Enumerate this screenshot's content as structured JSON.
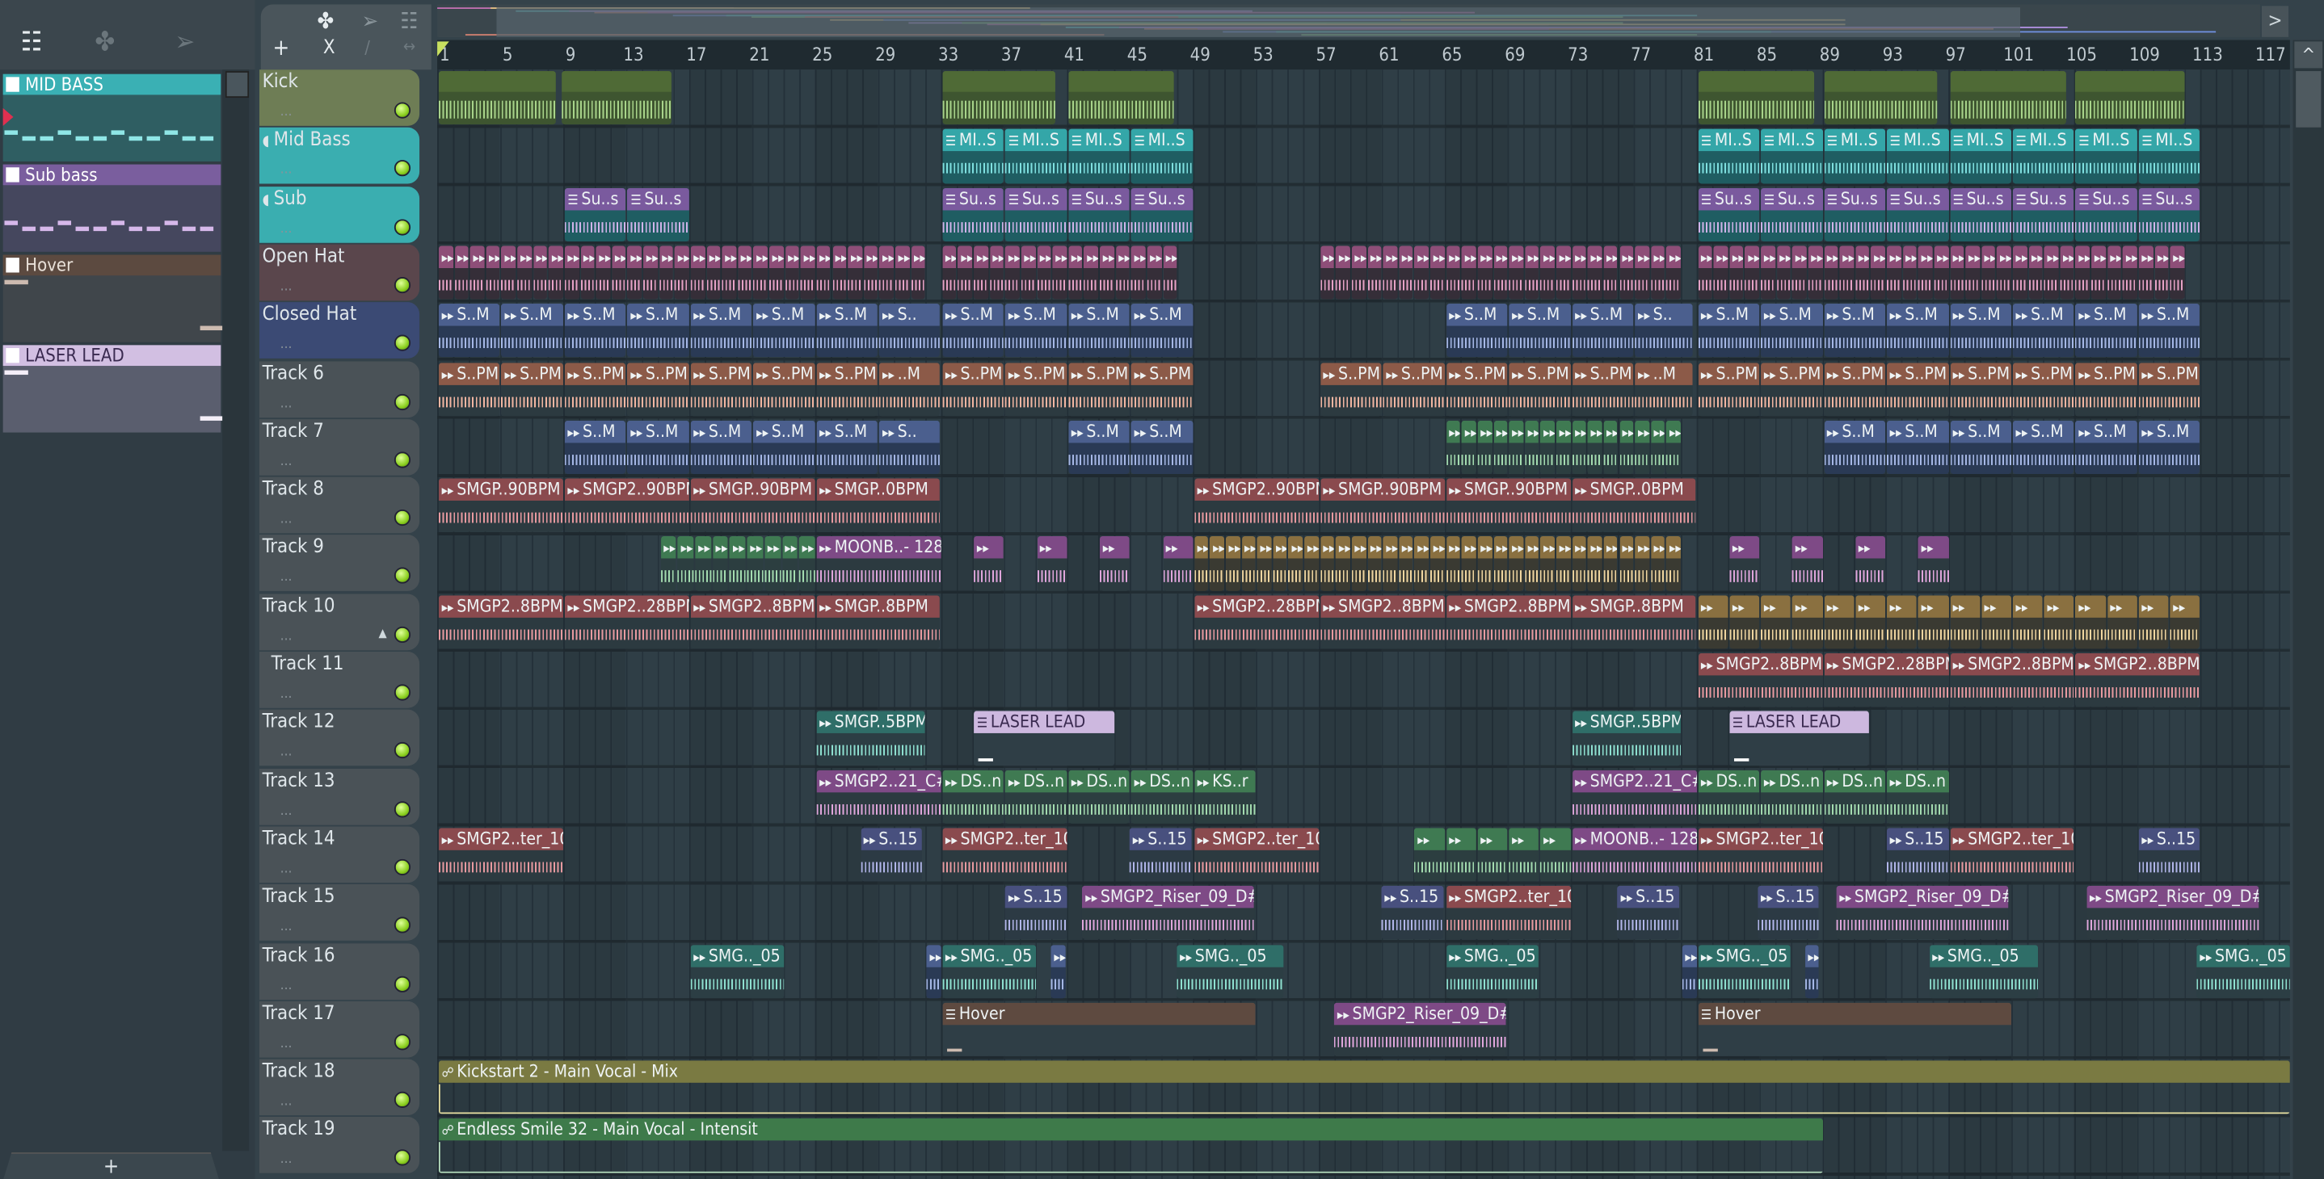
{
  "picker": {
    "items": [
      {
        "label": "MID BASS",
        "head": "#3ab0b4",
        "body": "#2f5e62",
        "text": "#ffffff",
        "note": "#8fe6e6"
      },
      {
        "label": "Sub bass",
        "head": "#7a5e9e",
        "body": "#45475e",
        "text": "#ffffff",
        "note": "#d6b8ea"
      },
      {
        "label": "Hover",
        "head": "#5c4a40",
        "body": "#40464b",
        "text": "#e8e0d8",
        "note": "#cdbbb0"
      },
      {
        "label": "LASER LEAD",
        "head": "#d2bfe2",
        "body": "#5a5e6e",
        "text": "#3a2a50",
        "note": "#f4eef8"
      }
    ],
    "add_label": "+"
  },
  "toolbar": {
    "add": "+",
    "delete": "X",
    "left": "<",
    "right": ">",
    "up": "^"
  },
  "ruler": {
    "bars": [
      1,
      5,
      9,
      13,
      17,
      21,
      25,
      29,
      33,
      37,
      41,
      45,
      49,
      53,
      57,
      61,
      65,
      69,
      73,
      77,
      81,
      85,
      89,
      93,
      97,
      101,
      105,
      109,
      113,
      117
    ]
  },
  "tracks": [
    {
      "name": "Kick",
      "color": "#6e7d55",
      "icon": false
    },
    {
      "name": "Mid Bass",
      "color": "#3aaeb0",
      "icon": true
    },
    {
      "name": "Sub",
      "color": "#3aaeb0",
      "icon": true
    },
    {
      "name": "Open Hat",
      "color": "#5a464c",
      "icon": false
    },
    {
      "name": "Closed Hat",
      "color": "#3b4a74",
      "icon": false
    },
    {
      "name": "Track 6"
    },
    {
      "name": "Track 7"
    },
    {
      "name": "Track 8"
    },
    {
      "name": "Track 9"
    },
    {
      "name": "Track 10"
    },
    {
      "name": "Track 11"
    },
    {
      "name": "Track 12"
    },
    {
      "name": "Track 13"
    },
    {
      "name": "Track 14"
    },
    {
      "name": "Track 15"
    },
    {
      "name": "Track 16"
    },
    {
      "name": "Track 17"
    },
    {
      "name": "Track 18"
    },
    {
      "name": "Track 19"
    }
  ],
  "colors": {
    "kick": {
      "head": "#4f6a36",
      "body": "#3e5530",
      "wave": "#a8d48a"
    },
    "teal": {
      "head": "#34a6a8",
      "body": "#1f5d62",
      "wave": "#7fe0e0"
    },
    "purple": {
      "head": "#7a5a9e",
      "body": "#1f5d62",
      "wave": "#d0b4ea"
    },
    "pink": {
      "head": "#8e4e78",
      "body": "#352e38",
      "wave": "#e6a2c6"
    },
    "blue": {
      "head": "#4b5f8e",
      "body": "#2a3a55",
      "wave": "#a6b8e6"
    },
    "brown": {
      "head": "#8c5a48",
      "body": "#2c3a40",
      "wave": "#f2b6a2"
    },
    "salmon": {
      "head": "#8a4a4e",
      "body": "#2c3a40",
      "wave": "#e89aa0"
    },
    "green": {
      "head": "#3f7a52",
      "body": "#2c3e40",
      "wave": "#a4dcb0"
    },
    "tan": {
      "head": "#8a7040",
      "body": "#3a3a32",
      "wave": "#f0d6a0"
    },
    "tealgreen": {
      "head": "#2f6e68",
      "body": "#2c3e44",
      "wave": "#8ee0d0"
    },
    "violet": {
      "head": "#7e4a86",
      "body": "#2c3a40",
      "wave": "#e0a6dc"
    },
    "indigo": {
      "head": "#48507e",
      "body": "#2c3a44",
      "wave": "#b2b6ea"
    },
    "lavender": {
      "head": "#cdb8df",
      "body": "#2f3e46",
      "wave": "#ffffff",
      "text": "#3a2a50"
    },
    "hover": {
      "head": "#5e4a40",
      "body": "#2f3e46",
      "wave": "#cdbbb0"
    },
    "olive": {
      "head": "#7a7a42",
      "body": "#2f3e46",
      "wave": "#e8e0a0"
    },
    "autogreen": {
      "head": "#3e7a4a",
      "body": "#2f3e46",
      "wave": "#b8e0c0"
    }
  },
  "clips": [
    {
      "t": 0,
      "s": 1,
      "l": 7.5,
      "c": "kick",
      "label": ""
    },
    {
      "t": 0,
      "s": 8.8,
      "l": 7.1,
      "c": "kick",
      "label": ""
    },
    {
      "t": 0,
      "s": 33,
      "l": 7.3,
      "c": "kick",
      "label": ""
    },
    {
      "t": 0,
      "s": 41,
      "l": 6.8,
      "c": "kick",
      "label": ""
    },
    {
      "t": 0,
      "s": 81,
      "l": 7.5,
      "c": "kick",
      "label": ""
    },
    {
      "t": 0,
      "s": 89,
      "l": 7.3,
      "c": "kick",
      "label": ""
    },
    {
      "t": 0,
      "s": 97,
      "l": 7.5,
      "c": "kick",
      "label": ""
    },
    {
      "t": 0,
      "s": 105,
      "l": 7,
      "c": "kick",
      "label": ""
    },
    {
      "t": 1,
      "s": 33,
      "l": 4,
      "n": 4,
      "c": "teal",
      "label": "MI..S"
    },
    {
      "t": 1,
      "s": 81,
      "l": 4,
      "n": 8,
      "c": "teal",
      "label": "MI..S"
    },
    {
      "t": 2,
      "s": 9,
      "l": 4,
      "n": 2,
      "c": "purple",
      "label": "Su..s"
    },
    {
      "t": 2,
      "s": 33,
      "l": 4,
      "n": 4,
      "c": "purple",
      "label": "Su..s"
    },
    {
      "t": 2,
      "s": 81,
      "l": 4,
      "n": 8,
      "c": "purple",
      "label": "Su..s"
    },
    {
      "t": 3,
      "s": 1,
      "l": 1,
      "n": 31,
      "c": "pink",
      "label": ""
    },
    {
      "t": 3,
      "s": 33,
      "l": 1,
      "n": 15,
      "c": "pink",
      "label": ""
    },
    {
      "t": 3,
      "s": 57,
      "l": 1,
      "n": 23,
      "c": "pink",
      "label": ""
    },
    {
      "t": 3,
      "s": 81,
      "l": 1,
      "n": 31,
      "c": "pink",
      "label": ""
    },
    {
      "t": 4,
      "s": 1,
      "l": 4,
      "n": 7,
      "c": "blue",
      "label": "S..M"
    },
    {
      "t": 4,
      "s": 29,
      "l": 3.9,
      "c": "blue",
      "label": "S.."
    },
    {
      "t": 4,
      "s": 33,
      "l": 4,
      "n": 4,
      "c": "blue",
      "label": "S..M"
    },
    {
      "t": 4,
      "s": 65,
      "l": 4,
      "n": 3,
      "c": "blue",
      "label": "S..M"
    },
    {
      "t": 4,
      "s": 77,
      "l": 3.8,
      "c": "blue",
      "label": "S.."
    },
    {
      "t": 4,
      "s": 81,
      "l": 4,
      "n": 8,
      "c": "blue",
      "label": "S..M"
    },
    {
      "t": 5,
      "s": 1,
      "l": 4,
      "n": 7,
      "c": "brown",
      "label": "S..PM"
    },
    {
      "t": 5,
      "s": 29,
      "l": 3.9,
      "c": "brown",
      "label": "..M"
    },
    {
      "t": 5,
      "s": 33,
      "l": 4,
      "n": 4,
      "c": "brown",
      "label": "S..PM"
    },
    {
      "t": 5,
      "s": 57,
      "l": 4,
      "n": 5,
      "c": "brown",
      "label": "S..PM"
    },
    {
      "t": 5,
      "s": 77,
      "l": 3.8,
      "c": "brown",
      "label": "..M"
    },
    {
      "t": 5,
      "s": 81,
      "l": 4,
      "n": 8,
      "c": "brown",
      "label": "S..PM"
    },
    {
      "t": 6,
      "s": 9,
      "l": 4,
      "n": 5,
      "c": "blue",
      "label": "S..M"
    },
    {
      "t": 6,
      "s": 29,
      "l": 3.9,
      "c": "blue",
      "label": "S.."
    },
    {
      "t": 6,
      "s": 41,
      "l": 4,
      "n": 2,
      "c": "blue",
      "label": "S..M"
    },
    {
      "t": 6,
      "s": 65,
      "l": 1,
      "n": 15,
      "c": "green",
      "label": ""
    },
    {
      "t": 6,
      "s": 89,
      "l": 4,
      "n": 6,
      "c": "blue",
      "label": "S..M"
    },
    {
      "t": 7,
      "s": 1,
      "l": 8,
      "c": "salmon",
      "label": "SMGP..90BPM"
    },
    {
      "t": 7,
      "s": 9,
      "l": 8,
      "c": "salmon",
      "label": "SMGP2..90BPM"
    },
    {
      "t": 7,
      "s": 17,
      "l": 8,
      "c": "salmon",
      "label": "SMGP..90BPM"
    },
    {
      "t": 7,
      "s": 25,
      "l": 7.9,
      "c": "salmon",
      "label": "SMGP..0BPM"
    },
    {
      "t": 7,
      "s": 49,
      "l": 8,
      "c": "salmon",
      "label": "SMGP2..90BPM"
    },
    {
      "t": 7,
      "s": 57,
      "l": 8,
      "c": "salmon",
      "label": "SMGP..90BPM"
    },
    {
      "t": 7,
      "s": 65,
      "l": 8,
      "c": "salmon",
      "label": "SMGP..90BPM"
    },
    {
      "t": 7,
      "s": 73,
      "l": 7.9,
      "c": "salmon",
      "label": "SMGP..0BPM"
    },
    {
      "t": 8,
      "s": 15.1,
      "l": 1.1,
      "n": 9,
      "c": "green",
      "label": ""
    },
    {
      "t": 8,
      "s": 25,
      "l": 8,
      "c": "violet",
      "label": "MOONB..- 128"
    },
    {
      "t": 8,
      "s": 35,
      "l": 2,
      "c": "violet",
      "label": ""
    },
    {
      "t": 8,
      "s": 39,
      "l": 2,
      "c": "violet",
      "label": ""
    },
    {
      "t": 8,
      "s": 43,
      "l": 2,
      "c": "violet",
      "label": ""
    },
    {
      "t": 8,
      "s": 47,
      "l": 2,
      "c": "violet",
      "label": ""
    },
    {
      "t": 8,
      "s": 49,
      "l": 1,
      "n": 31,
      "c": "tan",
      "label": ""
    },
    {
      "t": 8,
      "s": 83,
      "l": 2,
      "c": "violet",
      "label": ""
    },
    {
      "t": 8,
      "s": 87,
      "l": 2,
      "c": "violet",
      "label": ""
    },
    {
      "t": 8,
      "s": 91,
      "l": 2,
      "c": "violet",
      "label": ""
    },
    {
      "t": 8,
      "s": 95,
      "l": 2,
      "c": "violet",
      "label": ""
    },
    {
      "t": 9,
      "s": 1,
      "l": 8,
      "c": "salmon",
      "label": "SMGP2..8BPM"
    },
    {
      "t": 9,
      "s": 9,
      "l": 8,
      "c": "salmon",
      "label": "SMGP2..28BPM"
    },
    {
      "t": 9,
      "s": 17,
      "l": 8,
      "c": "salmon",
      "label": "SMGP2..8BPM"
    },
    {
      "t": 9,
      "s": 25,
      "l": 7.9,
      "c": "salmon",
      "label": "SMGP..8BPM"
    },
    {
      "t": 9,
      "s": 49,
      "l": 8,
      "c": "salmon",
      "label": "SMGP2..28BPM"
    },
    {
      "t": 9,
      "s": 57,
      "l": 8,
      "c": "salmon",
      "label": "SMGP2..8BPM"
    },
    {
      "t": 9,
      "s": 65,
      "l": 8,
      "c": "salmon",
      "label": "SMGP2..8BPM"
    },
    {
      "t": 9,
      "s": 73,
      "l": 7.9,
      "c": "salmon",
      "label": "SMGP..8BPM"
    },
    {
      "t": 9,
      "s": 81,
      "l": 2,
      "n": 16,
      "c": "tan",
      "label": ""
    },
    {
      "t": 10,
      "s": 81,
      "l": 8,
      "c": "salmon",
      "label": "SMGP2..8BPM"
    },
    {
      "t": 10,
      "s": 89,
      "l": 8,
      "c": "salmon",
      "label": "SMGP2..28BPM"
    },
    {
      "t": 10,
      "s": 97,
      "l": 8,
      "c": "salmon",
      "label": "SMGP2..8BPM"
    },
    {
      "t": 10,
      "s": 105,
      "l": 8,
      "c": "salmon",
      "label": "SMGP2..8BPM"
    },
    {
      "t": 11,
      "s": 25,
      "l": 7,
      "c": "tealgreen",
      "label": "SMGP..5BPM"
    },
    {
      "t": 11,
      "s": 35,
      "l": 9,
      "c": "lavender",
      "label": "LASER LEAD"
    },
    {
      "t": 11,
      "s": 73,
      "l": 7,
      "c": "tealgreen",
      "label": "SMGP..5BPM"
    },
    {
      "t": 11,
      "s": 83,
      "l": 9,
      "c": "lavender",
      "label": "LASER LEAD"
    },
    {
      "t": 12,
      "s": 25,
      "l": 8,
      "c": "violet",
      "label": "SMGP2..21_C#"
    },
    {
      "t": 12,
      "s": 33,
      "l": 4,
      "n": 4,
      "c": "green",
      "label": "DS..n"
    },
    {
      "t": 12,
      "s": 49,
      "l": 4,
      "c": "green",
      "label": "KS..r"
    },
    {
      "t": 12,
      "s": 73,
      "l": 8,
      "c": "violet",
      "label": "SMGP2..21_C#"
    },
    {
      "t": 12,
      "s": 81,
      "l": 4,
      "n": 4,
      "c": "green",
      "label": "DS..n"
    },
    {
      "t": 13,
      "s": 1,
      "l": 8,
      "c": "salmon",
      "label": "SMGP2..ter_10"
    },
    {
      "t": 13,
      "s": 27.8,
      "l": 4,
      "c": "indigo",
      "label": "S..15"
    },
    {
      "t": 13,
      "s": 33,
      "l": 8,
      "c": "salmon",
      "label": "SMGP2..ter_10"
    },
    {
      "t": 13,
      "s": 44.9,
      "l": 4,
      "c": "indigo",
      "label": "S..15"
    },
    {
      "t": 13,
      "s": 49,
      "l": 8,
      "c": "salmon",
      "label": "SMGP2..ter_10"
    },
    {
      "t": 13,
      "s": 63,
      "l": 2,
      "n": 5,
      "c": "green",
      "label": ""
    },
    {
      "t": 13,
      "s": 73,
      "l": 8,
      "c": "violet",
      "label": "MOONB..- 128"
    },
    {
      "t": 13,
      "s": 81,
      "l": 8,
      "c": "salmon",
      "label": "SMGP2..ter_10"
    },
    {
      "t": 13,
      "s": 93,
      "l": 4,
      "c": "indigo",
      "label": "S..15"
    },
    {
      "t": 13,
      "s": 97,
      "l": 8,
      "c": "salmon",
      "label": "SMGP2..ter_10"
    },
    {
      "t": 13,
      "s": 109,
      "l": 4,
      "c": "indigo",
      "label": "S..15"
    },
    {
      "t": 14,
      "s": 37,
      "l": 4,
      "c": "indigo",
      "label": "S..15"
    },
    {
      "t": 14,
      "s": 41.9,
      "l": 11,
      "c": "violet",
      "label": "SMGP2_Riser_09_D#"
    },
    {
      "t": 14,
      "s": 60.9,
      "l": 4,
      "c": "indigo",
      "label": "S..15"
    },
    {
      "t": 14,
      "s": 65,
      "l": 8,
      "c": "salmon",
      "label": "SMGP2..ter_10"
    },
    {
      "t": 14,
      "s": 75.9,
      "l": 4,
      "c": "indigo",
      "label": "S..15"
    },
    {
      "t": 14,
      "s": 84.8,
      "l": 4,
      "c": "indigo",
      "label": "S..15"
    },
    {
      "t": 14,
      "s": 89.8,
      "l": 11,
      "c": "violet",
      "label": "SMGP2_Riser_09_D#"
    },
    {
      "t": 14,
      "s": 105.7,
      "l": 11,
      "c": "violet",
      "label": "SMGP2_Riser_09_D#"
    },
    {
      "t": 15,
      "s": 17,
      "l": 6,
      "c": "tealgreen",
      "label": "SMG.._05"
    },
    {
      "t": 15,
      "s": 32,
      "l": 1,
      "c": "blue",
      "label": ""
    },
    {
      "t": 15,
      "s": 33,
      "l": 6,
      "c": "tealgreen",
      "label": "SMG.._05"
    },
    {
      "t": 15,
      "s": 39.9,
      "l": 1,
      "c": "blue",
      "label": ""
    },
    {
      "t": 15,
      "s": 47.9,
      "l": 6.9,
      "c": "tealgreen",
      "label": "SMG.._05"
    },
    {
      "t": 15,
      "s": 65,
      "l": 6,
      "c": "tealgreen",
      "label": "SMG.._05"
    },
    {
      "t": 15,
      "s": 80,
      "l": 1,
      "c": "blue",
      "label": ""
    },
    {
      "t": 15,
      "s": 81,
      "l": 6,
      "c": "tealgreen",
      "label": "SMG.._05"
    },
    {
      "t": 15,
      "s": 87.8,
      "l": 1,
      "c": "blue",
      "label": ""
    },
    {
      "t": 15,
      "s": 95.7,
      "l": 7,
      "c": "tealgreen",
      "label": "SMG.._05"
    },
    {
      "t": 15,
      "s": 112.7,
      "l": 6,
      "c": "tealgreen",
      "label": "SMG.._05"
    },
    {
      "t": 16,
      "s": 33,
      "l": 20,
      "c": "hover",
      "label": "Hover"
    },
    {
      "t": 16,
      "s": 57.9,
      "l": 11,
      "c": "violet",
      "label": "SMGP2_Riser_09_D#"
    },
    {
      "t": 16,
      "s": 81,
      "l": 20,
      "c": "hover",
      "label": "Hover"
    },
    {
      "t": 17,
      "s": 1,
      "l": 117.7,
      "c": "olive",
      "label": "Kickstart 2 - Main Vocal - Mix",
      "auto": true
    },
    {
      "t": 18,
      "s": 1,
      "l": 88,
      "c": "autogreen",
      "label": "Endless Smile 32 - Main Vocal - Intensit",
      "auto": true
    }
  ]
}
